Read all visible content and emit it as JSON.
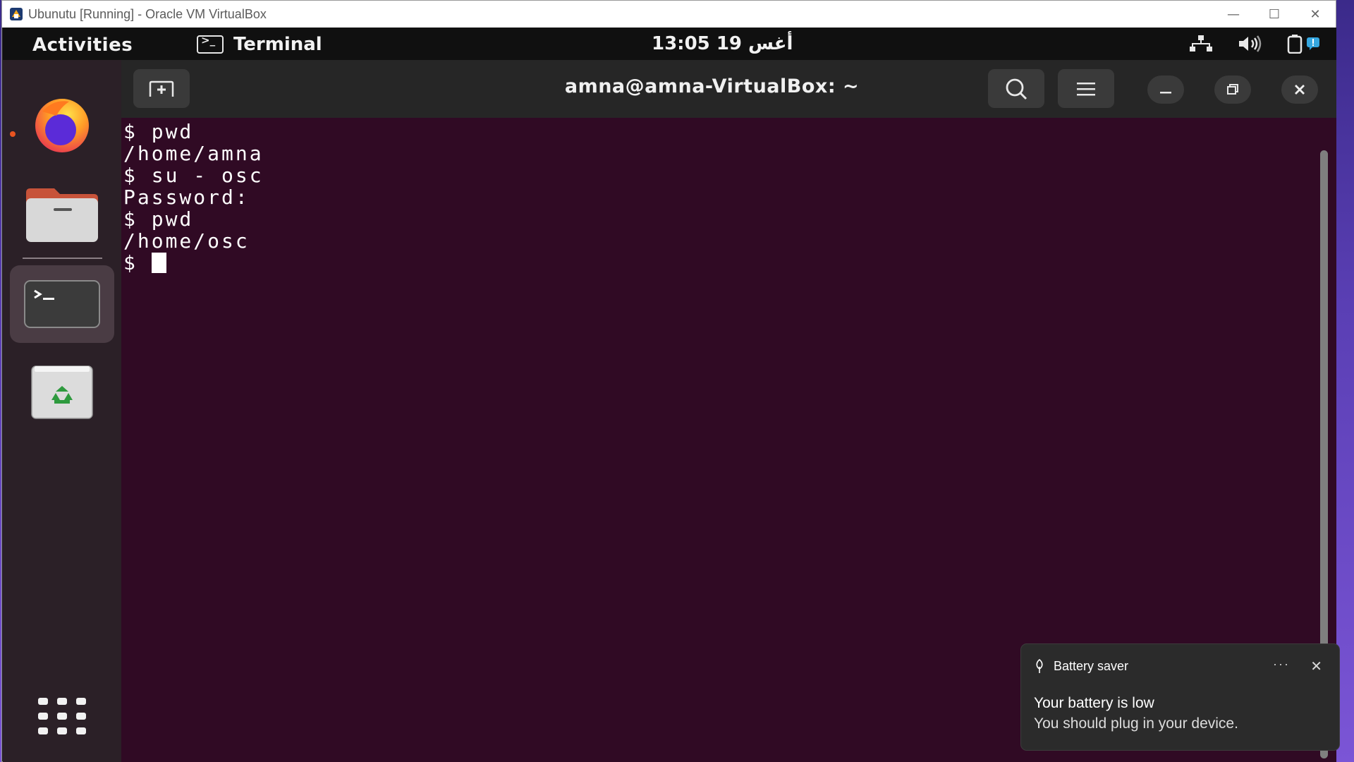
{
  "vbox": {
    "title": "Ubunutu [Running] - Oracle VM VirtualBox",
    "minimize_glyph": "—",
    "maximize_glyph": "☐",
    "close_glyph": "✕"
  },
  "topbar": {
    "activities": "Activities",
    "app_name": "Terminal",
    "clock": "13:05  19 أغس",
    "tray_icons": [
      "network-icon",
      "volume-icon",
      "battery-icon",
      "notification-icon"
    ]
  },
  "dock": {
    "items": [
      {
        "name": "firefox",
        "running": true
      },
      {
        "name": "files",
        "running": false
      },
      {
        "name": "terminal",
        "running": true,
        "active": true
      },
      {
        "name": "trash",
        "running": false
      },
      {
        "name": "show-applications",
        "running": false
      }
    ]
  },
  "terminal": {
    "title": "amna@amna-VirtualBox: ~",
    "lines": [
      "$ pwd",
      "/home/amna",
      "$ su - osc",
      "Password:",
      "$ pwd",
      "/home/osc"
    ],
    "prompt": "$ "
  },
  "toast": {
    "app": "Battery saver",
    "more": "···",
    "close": "✕",
    "title": "Your battery is low",
    "body": "You should plug in your device."
  },
  "colors": {
    "terminal_bg": "#300a24",
    "accent": "#e95420",
    "topbar_bg": "#101010"
  }
}
